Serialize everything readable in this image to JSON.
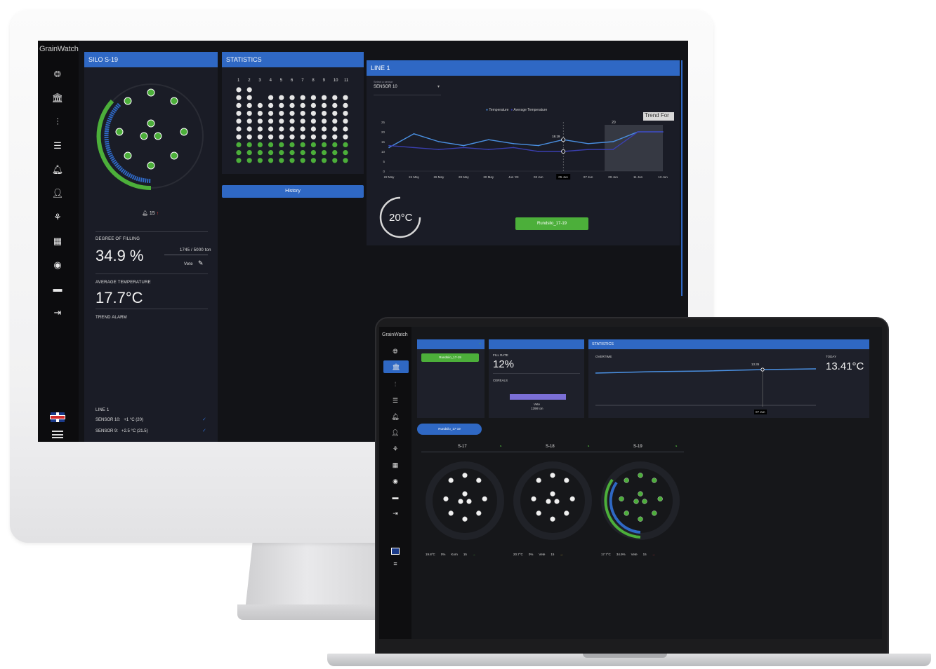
{
  "desktop": {
    "brand": "GrainWatch",
    "silo_panel": {
      "title": "SILO S-19",
      "alarm_count": "15",
      "fill_label": "DEGREE OF FILLING",
      "fill_value": "34.9 %",
      "tonnage": "1745 / 5000 ton",
      "crop": "Vete",
      "avg_temp_label": "AVERAGE TEMPERATURE",
      "avg_temp_value": "17.7°C",
      "trend_alarm_label": "TREND ALARM",
      "line_label": "LINE 1",
      "sensors": [
        {
          "name": "SENSOR 10:",
          "value": "+1 °C (20)"
        },
        {
          "name": "SENSOR 9:",
          "value": "+2.5 °C (21.5)"
        }
      ]
    },
    "statistics_panel": {
      "title": "STATISTICS",
      "columns": [
        "1",
        "2",
        "3",
        "4",
        "5",
        "6",
        "7",
        "8",
        "9",
        "10",
        "11"
      ],
      "history_button": "History"
    },
    "line_panel": {
      "title": "LINE 1",
      "sensor_select_label": "Select a sensor",
      "sensor_select_value": "SENSOR 10",
      "legend": [
        "Temperature",
        "Average Temperature"
      ],
      "trend_label": "Trend For",
      "marker_value": "18.19",
      "marker_value_2": "20",
      "current_temp": "20°C",
      "location_button": "Rundsilo_17-19"
    }
  },
  "laptop": {
    "brand": "GrainWatch",
    "location_button": "Rundsilo_17-19",
    "fill_rate_label": "FILL RATE",
    "fill_rate_value": "12%",
    "cereals_label": "CEREALS",
    "cereal_name": "Vete",
    "cereal_tons": "1298 ton",
    "statistics_title": "STATISTICS",
    "overtime_label": "OVERTIME",
    "today_label": "TODAY",
    "today_value": "13.41°C",
    "marker_value": "13.35",
    "marker_date": "07 Jun",
    "group_tab": "Rundsilo_17-19",
    "silos": [
      {
        "name": "S-17",
        "status": [
          "19.8°C",
          "0%",
          "Korn",
          "15"
        ]
      },
      {
        "name": "S-18",
        "status": [
          "20.7°C",
          "0%",
          "Vete",
          "15"
        ]
      },
      {
        "name": "S-19",
        "status": [
          "17.7°C",
          "34.9%",
          "Vete",
          "15"
        ]
      }
    ]
  },
  "chart_data": {
    "type": "line",
    "x": [
      "22 May",
      "24 May",
      "26 May",
      "28 May",
      "30 May",
      "Jun '23",
      "03 Jun",
      "05 Jun",
      "07 Jun",
      "09 Jun",
      "11 Jun",
      "13 Jun"
    ],
    "series": [
      {
        "name": "Temperature",
        "values": [
          12,
          19,
          15,
          13,
          16,
          14,
          13,
          16,
          14,
          15,
          20,
          20
        ]
      },
      {
        "name": "Average Temperature",
        "values": [
          13,
          12,
          11,
          12,
          11,
          12,
          10,
          10,
          11,
          11,
          20,
          20
        ]
      }
    ],
    "ylim": [
      0,
      25
    ],
    "yticks": [
      "0",
      "5",
      "10",
      "15",
      "20",
      "25"
    ],
    "colors": {
      "Temperature": "#4a90e2",
      "Average Temperature": "#3a3fb0"
    }
  }
}
